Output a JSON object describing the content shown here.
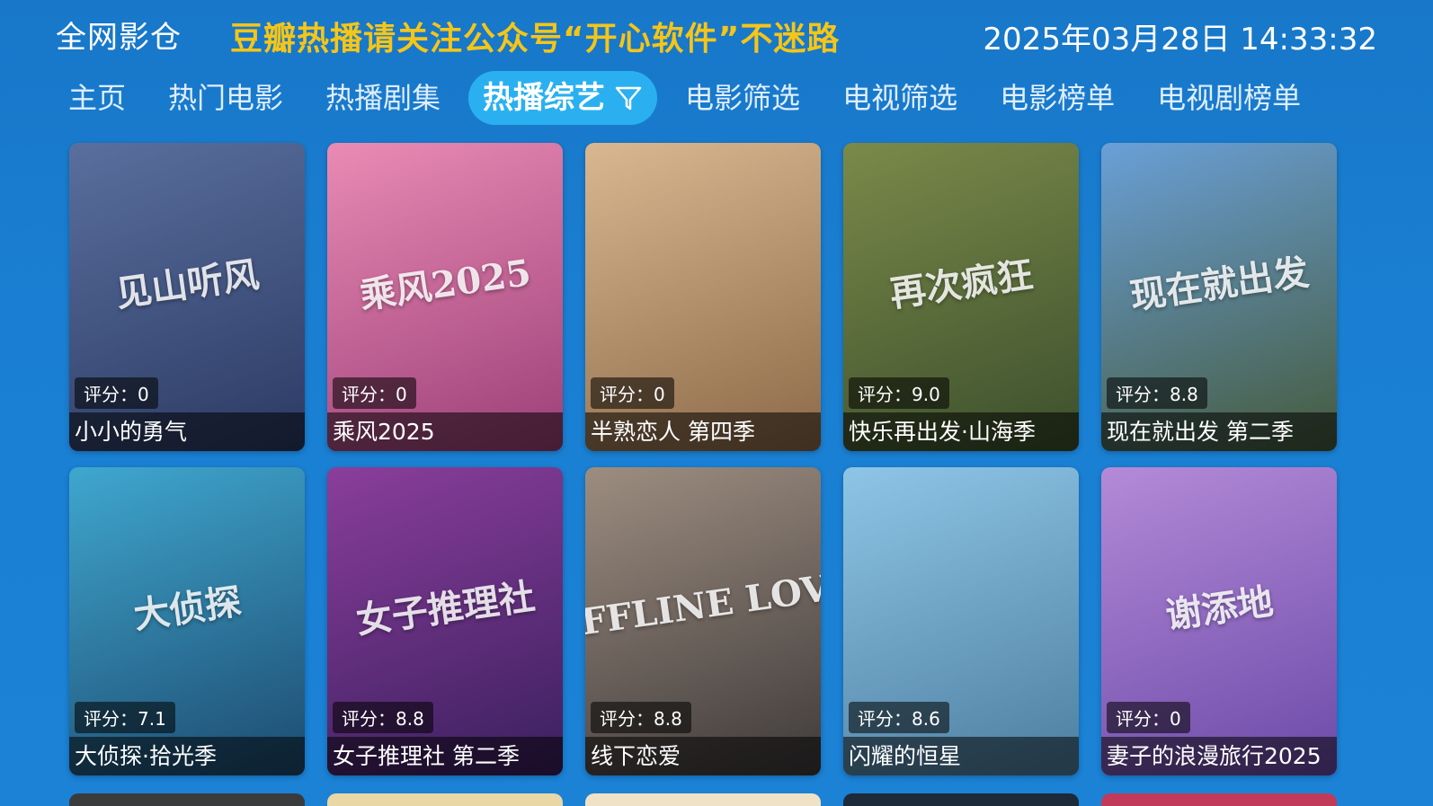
{
  "header": {
    "app_title": "全网影仓",
    "notice": "豆瓣热播请关注公众号“开心软件”不迷路",
    "datetime": "2025年03月28日 14:33:32"
  },
  "nav": {
    "items": [
      {
        "label": "主页"
      },
      {
        "label": "热门电影"
      },
      {
        "label": "热播剧集"
      },
      {
        "label": "热播综艺",
        "active": true,
        "icon": "filter-icon"
      },
      {
        "label": "电影筛选"
      },
      {
        "label": "电视筛选"
      },
      {
        "label": "电影榜单"
      },
      {
        "label": "电视剧榜单"
      }
    ]
  },
  "cards": [
    {
      "title": "小小的勇气",
      "rating": "评分：0",
      "poster_text": "见山听风",
      "colors": [
        "#5a6f9e",
        "#2b3a63"
      ]
    },
    {
      "title": "乘风2025",
      "rating": "评分：0",
      "poster_text": "乘风2025",
      "colors": [
        "#e98bb4",
        "#9c3f78"
      ]
    },
    {
      "title": "半熟恋人 第四季",
      "rating": "评分：0",
      "poster_text": "",
      "colors": [
        "#d9b790",
        "#8c6a48"
      ]
    },
    {
      "title": "快乐再出发·山海季",
      "rating": "评分：9.0",
      "poster_text": "再次疯狂",
      "colors": [
        "#7a8a4a",
        "#3c4f2c"
      ]
    },
    {
      "title": "现在就出发 第二季",
      "rating": "评分：8.8",
      "poster_text": "现在就出发",
      "colors": [
        "#6aa0d8",
        "#455a3c"
      ]
    },
    {
      "title": "大侦探·拾光季",
      "rating": "评分：7.1",
      "poster_text": "大侦探",
      "colors": [
        "#3fa7cf",
        "#1d4a6f"
      ]
    },
    {
      "title": "女子推理社 第二季",
      "rating": "评分：8.8",
      "poster_text": "女子推理社",
      "colors": [
        "#8a3e9b",
        "#3a1f5e"
      ]
    },
    {
      "title": "线下恋爱",
      "rating": "评分：8.8",
      "poster_text": "OFFLINE LOVE",
      "colors": [
        "#9d8d80",
        "#3e3a3a"
      ]
    },
    {
      "title": "闪耀的恒星",
      "rating": "评分：8.6",
      "poster_text": "",
      "colors": [
        "#8ec5e6",
        "#4d7ea0"
      ]
    },
    {
      "title": "妻子的浪漫旅行2025",
      "rating": "评分：0",
      "poster_text": "谢添地",
      "colors": [
        "#b48ad8",
        "#6b4aa8"
      ]
    }
  ],
  "partial_colors": [
    "#3a3b3d",
    "#e9d8a6",
    "#f0e2c6",
    "#1d2a3a",
    "#c23a5a"
  ]
}
